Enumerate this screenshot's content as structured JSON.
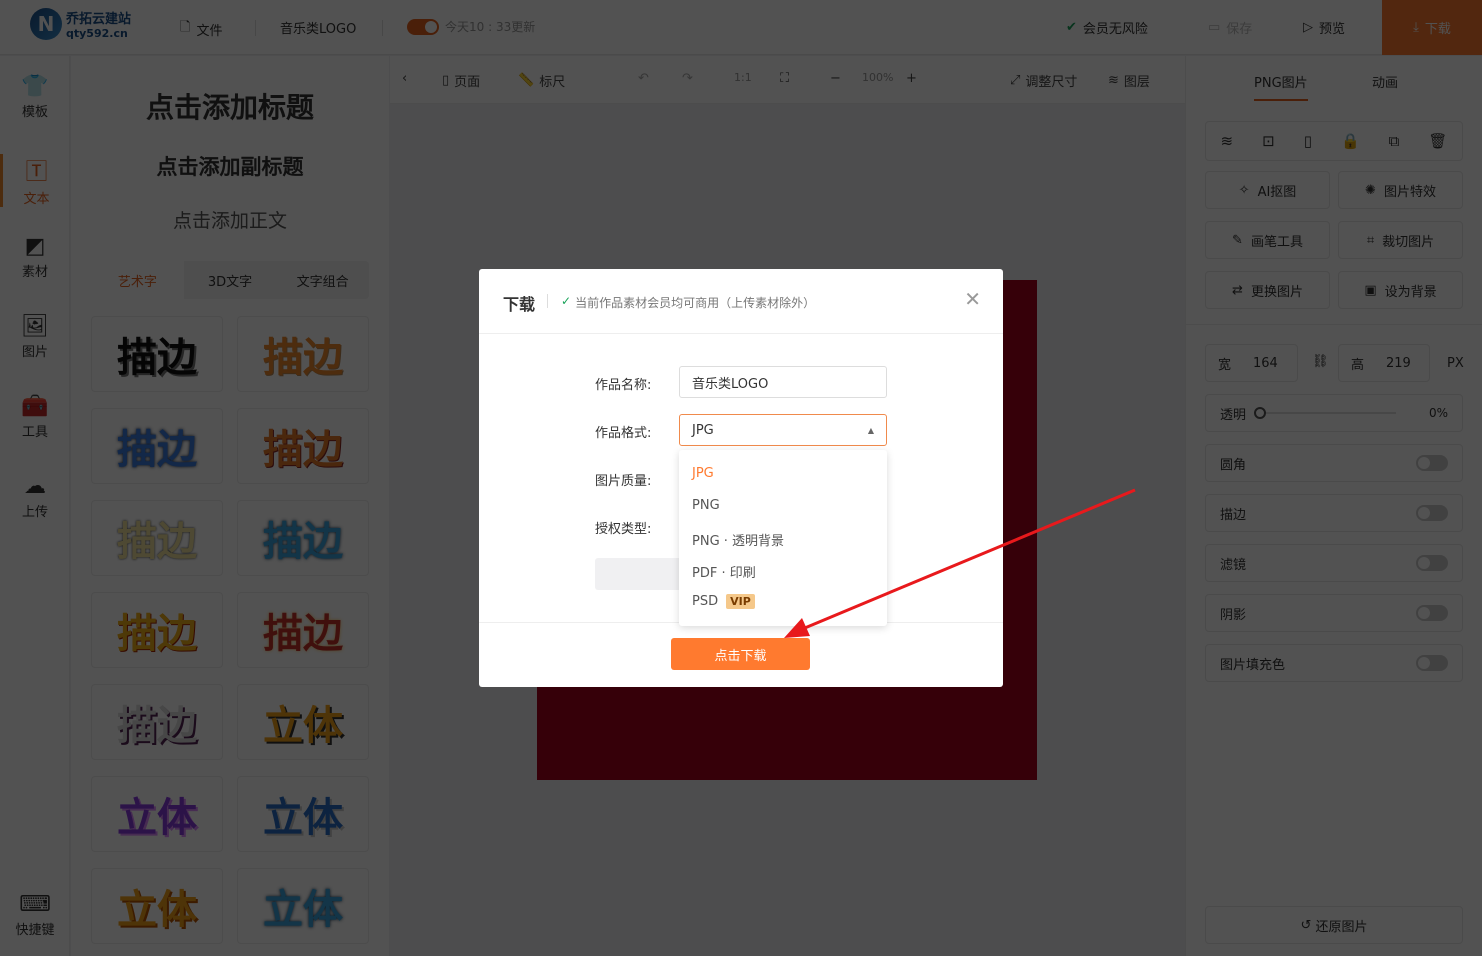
{
  "header": {
    "logo_name": "乔拓云建站",
    "logo_domain": "qty592.cn",
    "file": "文件",
    "doc_title": "音乐类LOGO",
    "autosave": "今天10 : 33更新",
    "member": "会员无风险",
    "save": "保存",
    "preview": "预览",
    "download": "下载"
  },
  "leftnav": [
    {
      "label": "模板",
      "icon": "tshirt-icon"
    },
    {
      "label": "文本",
      "icon": "text-icon"
    },
    {
      "label": "素材",
      "icon": "shapes-icon"
    },
    {
      "label": "图片",
      "icon": "image-icon"
    },
    {
      "label": "工具",
      "icon": "toolbox-icon"
    },
    {
      "label": "上传",
      "icon": "cloud-upload-icon"
    },
    {
      "label": "快捷键",
      "icon": "keyboard-icon"
    }
  ],
  "panel": {
    "add_title": "点击添加标题",
    "add_subtitle": "点击添加副标题",
    "add_body": "点击添加正文",
    "tabs": [
      "艺术字",
      "3D文字",
      "文字组合"
    ],
    "tiles": [
      "描边",
      "描边",
      "描边",
      "描边",
      "描边",
      "描边",
      "描边",
      "描边",
      "描边",
      "立体",
      "立体",
      "立体",
      "立体",
      "立体"
    ]
  },
  "toolbar": {
    "page": "页面",
    "ruler": "标尺",
    "ratio": "1:1",
    "zoom": "100%",
    "resize": "调整尺寸",
    "layers": "图层"
  },
  "right": {
    "tabs": [
      "PNG图片",
      "动画"
    ],
    "buttons": [
      "AI抠图",
      "图片特效",
      "画笔工具",
      "裁切图片",
      "更换图片",
      "设为背景"
    ],
    "width_label": "宽",
    "width": "164",
    "height_label": "高",
    "height": "219",
    "unit": "PX",
    "opacity_label": "透明",
    "opacity": "0%",
    "toggles": [
      "圆角",
      "描边",
      "滤镜",
      "阴影",
      "图片填充色"
    ],
    "restore": "还原图片"
  },
  "modal": {
    "title": "下载",
    "notice": "当前作品素材会员均可商用（上传素材除外）",
    "name_label": "作品名称:",
    "name_value": "音乐类LOGO",
    "format_label": "作品格式:",
    "format_value": "JPG",
    "quality_label": "图片质量:",
    "license_label": "授权类型:",
    "options": [
      "JPG",
      "PNG",
      "PNG · 透明背景",
      "PDF · 印刷",
      "PSD"
    ],
    "vip": "VIP",
    "submit": "点击下载"
  },
  "colors": {
    "accent": "#ff7a2f",
    "arrow": "#e8191c",
    "canvas": "#a8001c"
  }
}
